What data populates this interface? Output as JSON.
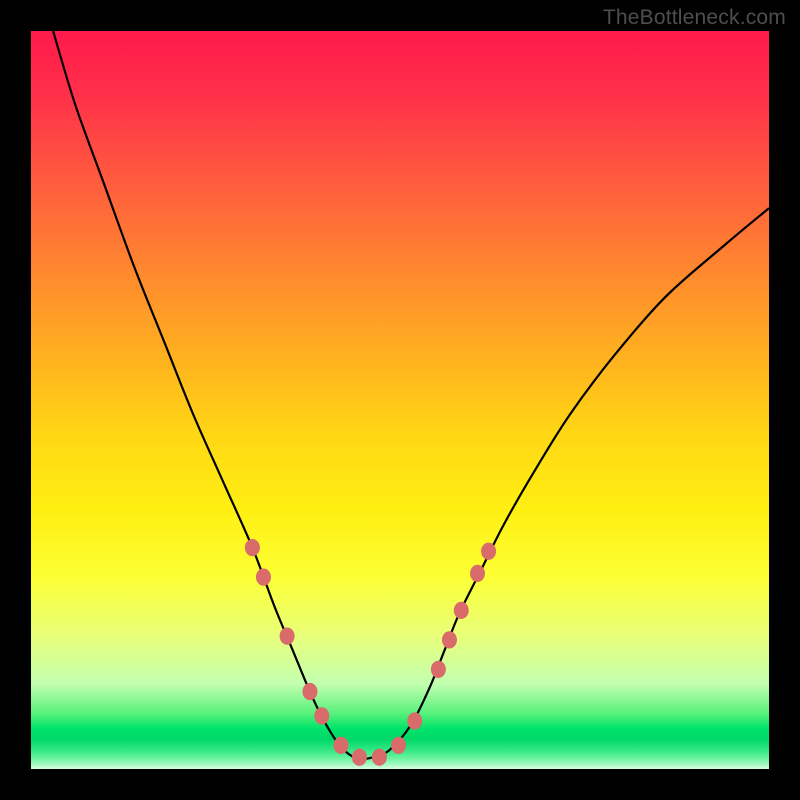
{
  "watermark": "TheBottleneck.com",
  "chart_data": {
    "type": "line",
    "title": "",
    "xlabel": "",
    "ylabel": "",
    "xlim": [
      0,
      100
    ],
    "ylim": [
      0,
      100
    ],
    "series": [
      {
        "name": "bottleneck-curve",
        "x": [
          3,
          6,
          10,
          14,
          18,
          22,
          26,
          30,
          33,
          35.5,
          38,
          40,
          42,
          44,
          46,
          48.5,
          51.5,
          54,
          56,
          58,
          61,
          64,
          68,
          73,
          79,
          86,
          94,
          100
        ],
        "y": [
          100,
          90,
          79,
          68,
          58,
          48,
          39,
          30,
          22,
          16,
          10,
          6,
          3,
          1.5,
          1.5,
          2.5,
          6,
          11,
          16,
          21,
          27,
          33,
          40,
          48,
          56,
          64,
          71,
          76
        ]
      }
    ],
    "markers": {
      "name": "highlight-dots",
      "points": [
        {
          "x": 30.0,
          "y": 30.0
        },
        {
          "x": 31.5,
          "y": 26.0
        },
        {
          "x": 34.7,
          "y": 18.0
        },
        {
          "x": 37.8,
          "y": 10.5
        },
        {
          "x": 39.4,
          "y": 7.2
        },
        {
          "x": 42.0,
          "y": 3.2
        },
        {
          "x": 44.5,
          "y": 1.6
        },
        {
          "x": 47.2,
          "y": 1.6
        },
        {
          "x": 49.8,
          "y": 3.2
        },
        {
          "x": 52.0,
          "y": 6.5
        },
        {
          "x": 55.2,
          "y": 13.5
        },
        {
          "x": 56.7,
          "y": 17.5
        },
        {
          "x": 58.3,
          "y": 21.5
        },
        {
          "x": 60.5,
          "y": 26.5
        },
        {
          "x": 62.0,
          "y": 29.5
        }
      ],
      "radius_px": 7.5
    },
    "background_gradient": {
      "top": "#ff1a4b",
      "mid": "#fff012",
      "bottom_band": "#00e46a"
    }
  }
}
